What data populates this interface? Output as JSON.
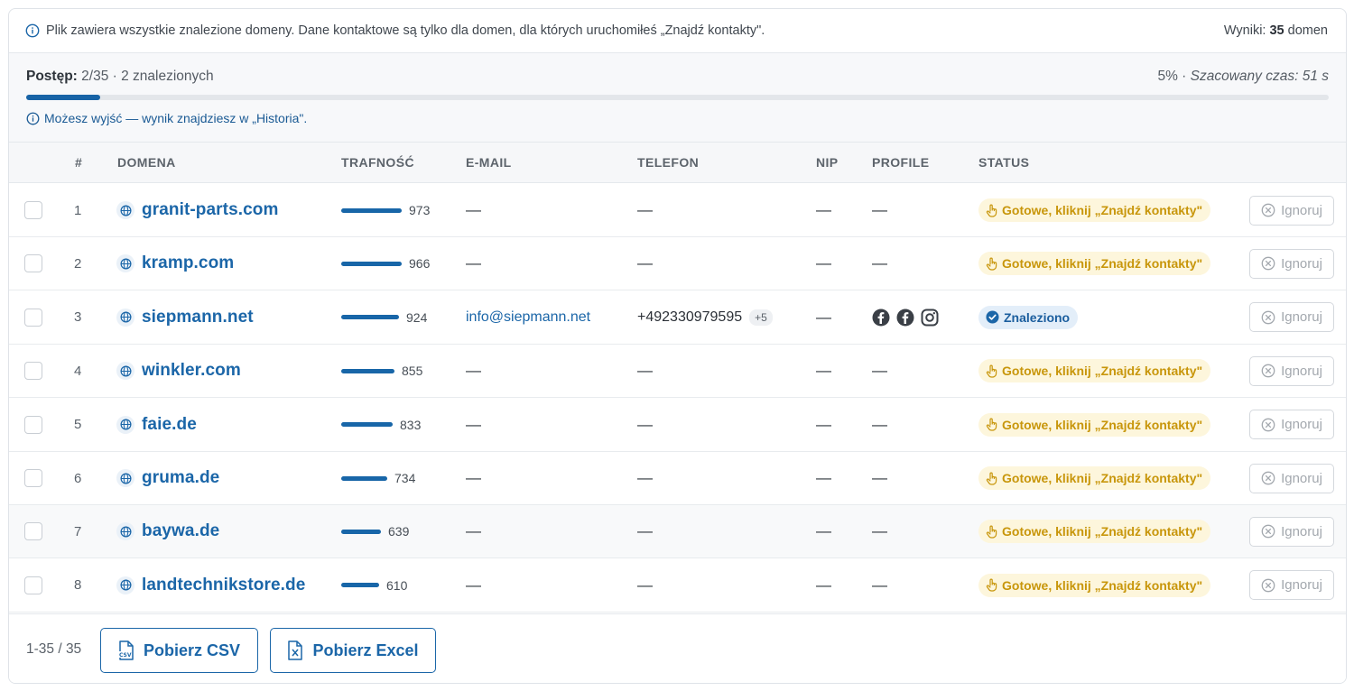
{
  "info": {
    "text": "Plik zawiera wszystkie znalezione domeny. Dane kontaktowe są tylko dla domen, dla których uruchomiłeś „Znajdź kontakty\".",
    "results_label": "Wyniki:",
    "results_count": "35",
    "results_unit": "domen"
  },
  "progress": {
    "label": "Postęp:",
    "value": "2/35 · 2 znalezionych",
    "percent_text": "5% ·",
    "estimate": "Szacowany czas: 51 s",
    "fraction": 0.057,
    "note": "Możesz wyjść — wynik znajdziesz w „Historia\"."
  },
  "table": {
    "columns": [
      "#",
      "DOMENA",
      "TRAFNOŚĆ",
      "E-MAIL",
      "TELEFON",
      "NIP",
      "PROFILE",
      "STATUS"
    ],
    "ignore_label": "Ignoruj",
    "dash": "—",
    "rows": [
      {
        "num": "1",
        "domain": "granit-parts.com",
        "score": "973",
        "score_fraction": 0.973,
        "email": "—",
        "phone": "—",
        "phone_more": "",
        "nip": "—",
        "profiles": "—",
        "status": "Gotowe, kliknij „Znajdź kontakty\"",
        "status_type": "ready"
      },
      {
        "num": "2",
        "domain": "kramp.com",
        "score": "966",
        "score_fraction": 0.966,
        "email": "—",
        "phone": "—",
        "phone_more": "",
        "nip": "—",
        "profiles": "—",
        "status": "Gotowe, kliknij „Znajdź kontakty\"",
        "status_type": "ready"
      },
      {
        "num": "3",
        "domain": "siepmann.net",
        "score": "924",
        "score_fraction": 0.924,
        "email": "info@siepmann.net",
        "phone": "+492330979595",
        "phone_more": "+5",
        "nip": "—",
        "profiles": [
          "facebook-icon",
          "facebook-icon",
          "instagram-icon"
        ],
        "status": "Znaleziono",
        "status_type": "found"
      },
      {
        "num": "4",
        "domain": "winkler.com",
        "score": "855",
        "score_fraction": 0.855,
        "email": "—",
        "phone": "—",
        "phone_more": "",
        "nip": "—",
        "profiles": "—",
        "status": "Gotowe, kliknij „Znajdź kontakty\"",
        "status_type": "ready"
      },
      {
        "num": "5",
        "domain": "faie.de",
        "score": "833",
        "score_fraction": 0.833,
        "email": "—",
        "phone": "—",
        "phone_more": "",
        "nip": "—",
        "profiles": "—",
        "status": "Gotowe, kliknij „Znajdź kontakty\"",
        "status_type": "ready"
      },
      {
        "num": "6",
        "domain": "gruma.de",
        "score": "734",
        "score_fraction": 0.734,
        "email": "—",
        "phone": "—",
        "phone_more": "",
        "nip": "—",
        "profiles": "—",
        "status": "Gotowe, kliknij „Znajdź kontakty\"",
        "status_type": "ready"
      },
      {
        "num": "7",
        "domain": "baywa.de",
        "score": "639",
        "score_fraction": 0.639,
        "email": "—",
        "phone": "—",
        "phone_more": "",
        "nip": "—",
        "profiles": "—",
        "status": "Gotowe, kliknij „Znajdź kontakty\"",
        "status_type": "ready"
      },
      {
        "num": "8",
        "domain": "landtechnikstore.de",
        "score": "610",
        "score_fraction": 0.61,
        "email": "—",
        "phone": "—",
        "phone_more": "",
        "nip": "—",
        "profiles": "—",
        "status": "Gotowe, kliknij „Znajdź kontakty\"",
        "status_type": "ready"
      }
    ]
  },
  "footer": {
    "range": "1-35 / 35",
    "csv_label": "Pobierz CSV",
    "excel_label": "Pobierz Excel"
  },
  "colors": {
    "accent": "#1b66a8",
    "ready_bg": "#fdf6dc",
    "ready_text": "#c8960b",
    "found_bg": "#e3eef9",
    "found_text": "#1b5e9e"
  }
}
